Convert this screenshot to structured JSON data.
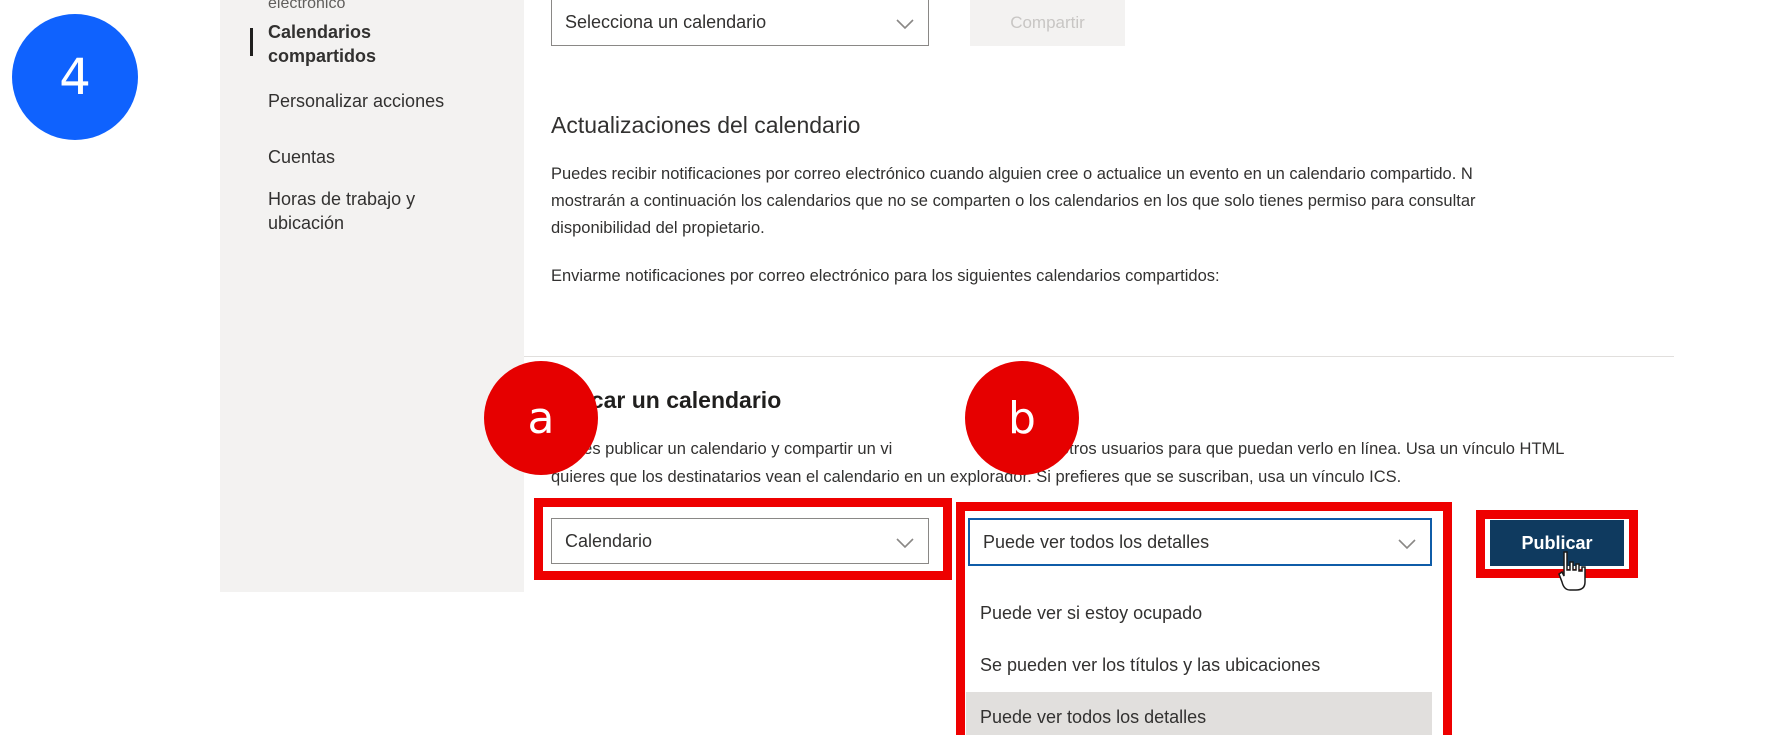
{
  "step_number": "4",
  "sidebar": {
    "items": [
      {
        "label": "electrónico"
      },
      {
        "label": "Calendarios"
      },
      {
        "label": "compartidos"
      },
      {
        "label": "Personalizar acciones"
      },
      {
        "label": "Cuentas"
      },
      {
        "label": "Horas de trabajo y"
      },
      {
        "label": "ubicación"
      }
    ]
  },
  "share": {
    "select_placeholder": "Selecciona un calendario",
    "share_button": "Compartir"
  },
  "updates": {
    "title": "Actualizaciones del calendario",
    "description_lines": [
      "Puedes recibir notificaciones por correo electrónico cuando alguien cree o actualice un evento en un calendario compartido. N",
      "mostrarán a continuación los calendarios que no se comparten o los calendarios en los que solo tienes permiso para consultar",
      "disponibilidad del propietario."
    ],
    "notify_label": "Enviarme notificaciones por correo electrónico para los siguientes calendarios compartidos:"
  },
  "publish": {
    "title_visible": "licar un calendario",
    "description_lines": [
      "des publicar un calendario y compartir un vi",
      "otros usuarios para que puedan verlo en línea. Usa un vínculo HTML",
      "quieres que los destinatarios vean el calendario en un explorador. Si prefieres que se suscriban, usa un vínculo ICS."
    ],
    "calendar_select_value": "Calendario",
    "permission_select_value": "Puede ver todos los detalles",
    "permission_options": [
      "Puede ver si estoy ocupado",
      "Se pueden ver los títulos y las ubicaciones",
      "Puede ver todos los detalles"
    ],
    "selected_option_index": 2,
    "publish_button": "Publicar"
  },
  "callouts": {
    "a": "a",
    "b": "b"
  },
  "colors": {
    "step_badge": "#0f62fe",
    "callout_red": "#e60000",
    "publish_button": "#0f3a5f"
  }
}
